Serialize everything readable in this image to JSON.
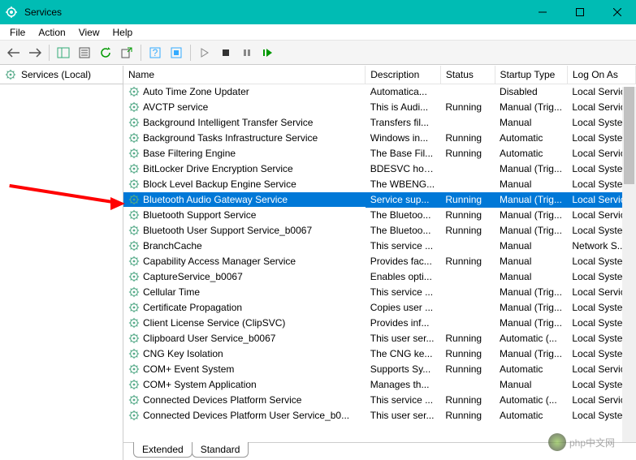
{
  "window": {
    "title": "Services"
  },
  "menu": {
    "file": "File",
    "action": "Action",
    "view": "View",
    "help": "Help"
  },
  "sidebar": {
    "root": "Services (Local)"
  },
  "columns": {
    "name": "Name",
    "desc": "Description",
    "status": "Status",
    "startup": "Startup Type",
    "logon": "Log On As"
  },
  "tabs": {
    "extended": "Extended",
    "standard": "Standard"
  },
  "selected_index": 7,
  "services": [
    {
      "name": "Auto Time Zone Updater",
      "desc": "Automatica...",
      "status": "",
      "startup": "Disabled",
      "logon": "Local Service"
    },
    {
      "name": "AVCTP service",
      "desc": "This is Audi...",
      "status": "Running",
      "startup": "Manual (Trig...",
      "logon": "Local Service"
    },
    {
      "name": "Background Intelligent Transfer Service",
      "desc": "Transfers fil...",
      "status": "",
      "startup": "Manual",
      "logon": "Local Syste..."
    },
    {
      "name": "Background Tasks Infrastructure Service",
      "desc": "Windows in...",
      "status": "Running",
      "startup": "Automatic",
      "logon": "Local Syste..."
    },
    {
      "name": "Base Filtering Engine",
      "desc": "The Base Fil...",
      "status": "Running",
      "startup": "Automatic",
      "logon": "Local Service"
    },
    {
      "name": "BitLocker Drive Encryption Service",
      "desc": "BDESVC hos...",
      "status": "",
      "startup": "Manual (Trig...",
      "logon": "Local Syste..."
    },
    {
      "name": "Block Level Backup Engine Service",
      "desc": "The WBENG...",
      "status": "",
      "startup": "Manual",
      "logon": "Local Syste..."
    },
    {
      "name": "Bluetooth Audio Gateway Service",
      "desc": "Service sup...",
      "status": "Running",
      "startup": "Manual (Trig...",
      "logon": "Local Service"
    },
    {
      "name": "Bluetooth Support Service",
      "desc": "The Bluetoo...",
      "status": "Running",
      "startup": "Manual (Trig...",
      "logon": "Local Service"
    },
    {
      "name": "Bluetooth User Support Service_b0067",
      "desc": "The Bluetoo...",
      "status": "Running",
      "startup": "Manual (Trig...",
      "logon": "Local Syste..."
    },
    {
      "name": "BranchCache",
      "desc": "This service ...",
      "status": "",
      "startup": "Manual",
      "logon": "Network S..."
    },
    {
      "name": "Capability Access Manager Service",
      "desc": "Provides fac...",
      "status": "Running",
      "startup": "Manual",
      "logon": "Local Syste..."
    },
    {
      "name": "CaptureService_b0067",
      "desc": "Enables opti...",
      "status": "",
      "startup": "Manual",
      "logon": "Local Syste..."
    },
    {
      "name": "Cellular Time",
      "desc": "This service ...",
      "status": "",
      "startup": "Manual (Trig...",
      "logon": "Local Service"
    },
    {
      "name": "Certificate Propagation",
      "desc": "Copies user ...",
      "status": "",
      "startup": "Manual (Trig...",
      "logon": "Local Syste..."
    },
    {
      "name": "Client License Service (ClipSVC)",
      "desc": "Provides inf...",
      "status": "",
      "startup": "Manual (Trig...",
      "logon": "Local Syste..."
    },
    {
      "name": "Clipboard User Service_b0067",
      "desc": "This user ser...",
      "status": "Running",
      "startup": "Automatic (...",
      "logon": "Local Syste..."
    },
    {
      "name": "CNG Key Isolation",
      "desc": "The CNG ke...",
      "status": "Running",
      "startup": "Manual (Trig...",
      "logon": "Local Syste..."
    },
    {
      "name": "COM+ Event System",
      "desc": "Supports Sy...",
      "status": "Running",
      "startup": "Automatic",
      "logon": "Local Service"
    },
    {
      "name": "COM+ System Application",
      "desc": "Manages th...",
      "status": "",
      "startup": "Manual",
      "logon": "Local Syste..."
    },
    {
      "name": "Connected Devices Platform Service",
      "desc": "This service ...",
      "status": "Running",
      "startup": "Automatic (...",
      "logon": "Local Service"
    },
    {
      "name": "Connected Devices Platform User Service_b0...",
      "desc": "This user ser...",
      "status": "Running",
      "startup": "Automatic",
      "logon": "Local Syste..."
    }
  ],
  "watermark": "php中文网"
}
